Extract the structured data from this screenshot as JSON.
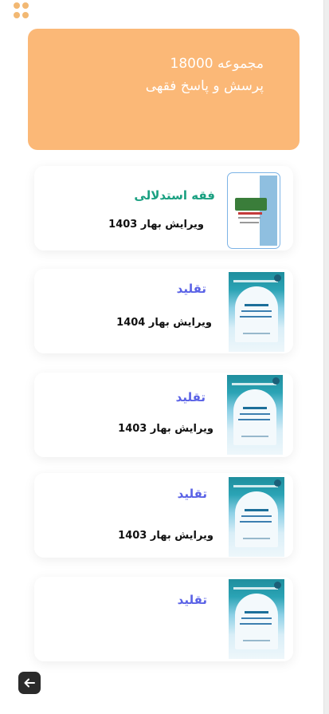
{
  "hero": {
    "line1": "مجموعه 18000",
    "line2": "پرسش و پاسخ فقهی"
  },
  "books": [
    {
      "title": "فقه استدلالی",
      "subtitle": "ویرایش بهار 1403",
      "title_color": "#1aa081"
    },
    {
      "title": "تقلید",
      "subtitle": "ویرایش بهار 1404",
      "title_color": "#5b63e6"
    },
    {
      "title": "تقلید",
      "subtitle": "ویرایش بهار 1403",
      "title_color": "#5b63e6"
    },
    {
      "title": "تقلید",
      "subtitle": "ویرایش بهار 1403",
      "title_color": "#5b63e6"
    },
    {
      "title": "تقلید",
      "subtitle": "",
      "title_color": "#5b63e6"
    }
  ],
  "icons": {
    "menu": "grid-dots-icon",
    "back": "arrow-left-icon"
  },
  "colors": {
    "hero_bg": "#fbb877",
    "accent_green": "#1aa081",
    "accent_blue": "#5b63e6"
  }
}
